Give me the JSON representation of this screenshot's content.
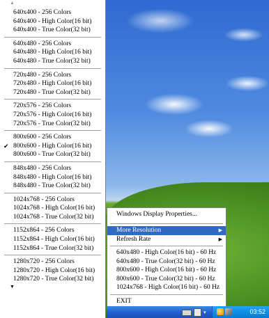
{
  "resolution_menu": {
    "groups": [
      [
        "640x400 - 256 Colors",
        "640x400 - High Color(16 bit)",
        "640x400 - True Color(32 bit)"
      ],
      [
        "640x480 - 256 Colors",
        "640x480 - High Color(16 bit)",
        "640x480 - True Color(32 bit)"
      ],
      [
        "720x480 - 256 Colors",
        "720x480 - High Color(16 bit)",
        "720x480 - True Color(32 bit)"
      ],
      [
        "720x576 - 256 Colors",
        "720x576 - High Color(16 bit)",
        "720x576 - True Color(32 bit)"
      ],
      [
        "800x600 - 256 Colors",
        "800x600 - High Color(16 bit)",
        "800x600 - True Color(32 bit)"
      ],
      [
        "848x480 - 256 Colors",
        "848x480 - High Color(16 bit)",
        "848x480 - True Color(32 bit)"
      ],
      [
        "1024x768 - 256 Colors",
        "1024x768 - High Color(16 bit)",
        "1024x768 - True Color(32 bit)"
      ],
      [
        "1152x864 - 256 Colors",
        "1152x864 - High Color(16 bit)",
        "1152x864 - True Color(32 bit)"
      ],
      [
        "1280x720 - 256 Colors",
        "1280x720 - High Color(16 bit)",
        "1280x720 - True Color(32 bit)"
      ]
    ],
    "checked_item": "800x600 - High Color(16 bit)",
    "check_glyph": "✔"
  },
  "context_menu": {
    "display_properties": "Windows Display Properties...",
    "more_resolution": "More Resolution",
    "refresh_rate": "Refresh Rate",
    "quick_modes": [
      "640x480 - High Color(16 bit) - 60 Hz",
      "640x480 - True Color(32 bit) - 60 Hz",
      "800x600 - High Color(16 bit) - 60 Hz",
      "800x600 - True Color(32 bit) - 60 Hz",
      "1024x768 - High Color(16 bit) - 60 Hz"
    ],
    "exit": "EXIT",
    "submenu_arrow": "▶"
  },
  "taskbar": {
    "clock": "03:52"
  },
  "colors": {
    "highlight": "#316ac5",
    "taskbar": "#2460cf",
    "tray": "#108ee6"
  }
}
